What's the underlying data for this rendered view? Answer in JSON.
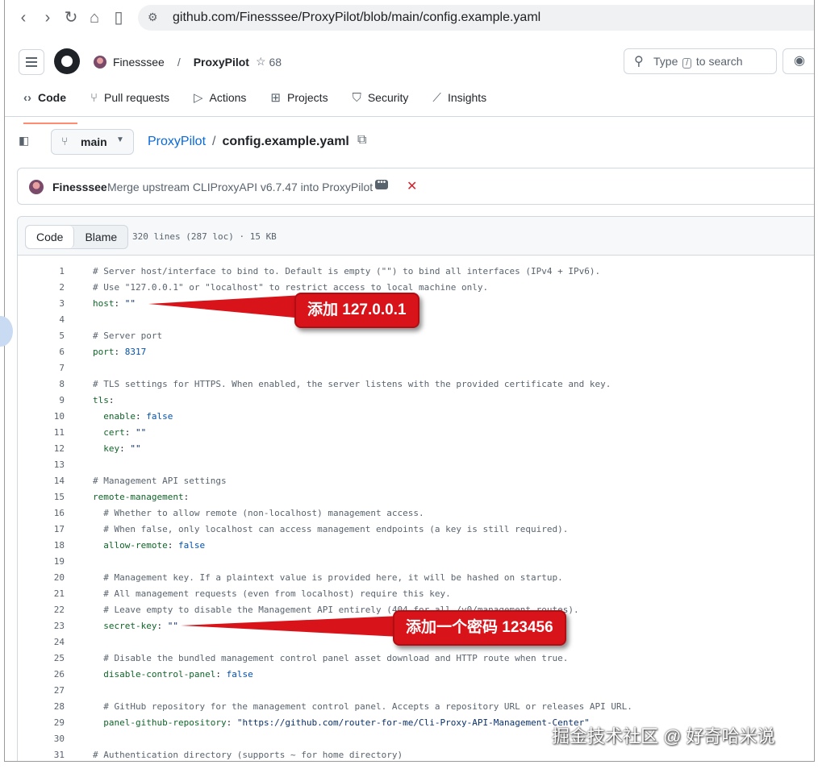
{
  "browser": {
    "url": "github.com/Finesssee/ProxyPilot/blob/main/config.example.yaml"
  },
  "header": {
    "owner": "Finesssee",
    "repo": "ProxyPilot",
    "stars": "68",
    "search_prefix": "Type",
    "search_key": "/",
    "search_suffix": "to search",
    "tabs": [
      {
        "label": "Code",
        "icon": "code-icon"
      },
      {
        "label": "Pull requests",
        "icon": "pull-request-icon"
      },
      {
        "label": "Actions",
        "icon": "play-icon"
      },
      {
        "label": "Projects",
        "icon": "table-icon"
      },
      {
        "label": "Security",
        "icon": "shield-icon"
      },
      {
        "label": "Insights",
        "icon": "graph-icon"
      }
    ]
  },
  "file_nav": {
    "branch": "main",
    "repo_link": "ProxyPilot",
    "separator": "/",
    "file_name": "config.example.yaml"
  },
  "commit": {
    "author": "Finesssee",
    "message": "Merge upstream CLIProxyAPI v6.7.47 into ProxyPilot"
  },
  "code_header": {
    "code_tab": "Code",
    "blame_tab": "Blame",
    "meta": "320 lines (287 loc) · 15 KB"
  },
  "code_lines": [
    {
      "n": "1",
      "parts": [
        {
          "t": "# Server host/interface to bind to. Default is empty (\"\") to bind all interfaces (IPv4 + IPv6).",
          "c": "com"
        }
      ]
    },
    {
      "n": "2",
      "parts": [
        {
          "t": "# Use \"127.0.0.1\" or \"localhost\" to restrict access to local machine only.",
          "c": "com"
        }
      ]
    },
    {
      "n": "3",
      "parts": [
        {
          "t": "host",
          "c": "key"
        },
        {
          "t": ": ",
          "c": ""
        },
        {
          "t": "\"\"",
          "c": "str"
        }
      ]
    },
    {
      "n": "4",
      "parts": []
    },
    {
      "n": "5",
      "parts": [
        {
          "t": "# Server port",
          "c": "com"
        }
      ]
    },
    {
      "n": "6",
      "parts": [
        {
          "t": "port",
          "c": "key"
        },
        {
          "t": ": ",
          "c": ""
        },
        {
          "t": "8317",
          "c": "bool"
        }
      ]
    },
    {
      "n": "7",
      "parts": []
    },
    {
      "n": "8",
      "parts": [
        {
          "t": "# TLS settings for HTTPS. When enabled, the server listens with the provided certificate and key.",
          "c": "com"
        }
      ]
    },
    {
      "n": "9",
      "parts": [
        {
          "t": "tls",
          "c": "key"
        },
        {
          "t": ":",
          "c": ""
        }
      ]
    },
    {
      "n": "10",
      "parts": [
        {
          "t": "  enable",
          "c": "key"
        },
        {
          "t": ": ",
          "c": ""
        },
        {
          "t": "false",
          "c": "bool"
        }
      ]
    },
    {
      "n": "11",
      "parts": [
        {
          "t": "  cert",
          "c": "key"
        },
        {
          "t": ": ",
          "c": ""
        },
        {
          "t": "\"\"",
          "c": "str"
        }
      ]
    },
    {
      "n": "12",
      "parts": [
        {
          "t": "  key",
          "c": "key"
        },
        {
          "t": ": ",
          "c": ""
        },
        {
          "t": "\"\"",
          "c": "str"
        }
      ]
    },
    {
      "n": "13",
      "parts": []
    },
    {
      "n": "14",
      "parts": [
        {
          "t": "# Management API settings",
          "c": "com"
        }
      ]
    },
    {
      "n": "15",
      "parts": [
        {
          "t": "remote-management",
          "c": "key"
        },
        {
          "t": ":",
          "c": ""
        }
      ]
    },
    {
      "n": "16",
      "parts": [
        {
          "t": "  # Whether to allow remote (non-localhost) management access.",
          "c": "com"
        }
      ]
    },
    {
      "n": "17",
      "parts": [
        {
          "t": "  # When false, only localhost can access management endpoints (a key is still required).",
          "c": "com"
        }
      ]
    },
    {
      "n": "18",
      "parts": [
        {
          "t": "  allow-remote",
          "c": "key"
        },
        {
          "t": ": ",
          "c": ""
        },
        {
          "t": "false",
          "c": "bool"
        }
      ]
    },
    {
      "n": "19",
      "parts": []
    },
    {
      "n": "20",
      "parts": [
        {
          "t": "  # Management key. If a plaintext value is provided here, it will be hashed on startup.",
          "c": "com"
        }
      ]
    },
    {
      "n": "21",
      "parts": [
        {
          "t": "  # All management requests (even from localhost) require this key.",
          "c": "com"
        }
      ]
    },
    {
      "n": "22",
      "parts": [
        {
          "t": "  # Leave empty to disable the Management API entirely (404 for all /v0/management routes).",
          "c": "com"
        }
      ]
    },
    {
      "n": "23",
      "parts": [
        {
          "t": "  secret-key",
          "c": "key"
        },
        {
          "t": ": ",
          "c": ""
        },
        {
          "t": "\"\"",
          "c": "str"
        }
      ]
    },
    {
      "n": "24",
      "parts": []
    },
    {
      "n": "25",
      "parts": [
        {
          "t": "  # Disable the bundled management control panel asset download and HTTP route when true.",
          "c": "com"
        }
      ]
    },
    {
      "n": "26",
      "parts": [
        {
          "t": "  disable-control-panel",
          "c": "key"
        },
        {
          "t": ": ",
          "c": ""
        },
        {
          "t": "false",
          "c": "bool"
        }
      ]
    },
    {
      "n": "27",
      "parts": []
    },
    {
      "n": "28",
      "parts": [
        {
          "t": "  # GitHub repository for the management control panel. Accepts a repository URL or releases API URL.",
          "c": "com"
        }
      ]
    },
    {
      "n": "29",
      "parts": [
        {
          "t": "  panel-github-repository",
          "c": "key"
        },
        {
          "t": ": ",
          "c": ""
        },
        {
          "t": "\"https://github.com/router-for-me/Cli-Proxy-API-Management-Center\"",
          "c": "str"
        }
      ]
    },
    {
      "n": "30",
      "parts": []
    },
    {
      "n": "31",
      "parts": [
        {
          "t": "# Authentication directory (supports ~ for home directory)",
          "c": "com"
        }
      ]
    }
  ],
  "annotations": {
    "host_note": "添加 127.0.0.1",
    "secret_note": "添加一个密码 123456"
  },
  "watermark": "掘金技术社区 @ 好奇哈米说",
  "colors": {
    "accent_tab": "#fd8c73",
    "link": "#0969da",
    "callout": "#d9131a"
  }
}
